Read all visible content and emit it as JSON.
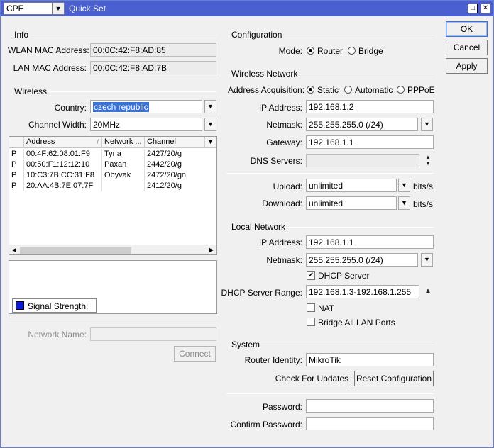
{
  "title": {
    "combo": "CPE",
    "text": "Quick Set"
  },
  "buttons": {
    "ok": "OK",
    "cancel": "Cancel",
    "apply": "Apply"
  },
  "info": {
    "label": "Info",
    "wlan_mac_label": "WLAN MAC Address:",
    "wlan_mac": "00:0C:42:F8:AD:85",
    "lan_mac_label": "LAN MAC Address:",
    "lan_mac": "00:0C:42:F8:AD:7B"
  },
  "wireless": {
    "label": "Wireless",
    "country_label": "Country:",
    "country": "czech republic",
    "channel_width_label": "Channel Width:",
    "channel_width": "20MHz",
    "columns": [
      "",
      "Address",
      "Network ...",
      "Channel"
    ],
    "rows": [
      [
        "P",
        "00:4F:62:08:01:F9",
        "Tyna",
        "2427/20/g"
      ],
      [
        "P",
        "00:50:F1:12:12:10",
        "Paxan",
        "2442/20/g"
      ],
      [
        "P",
        "10:C3:7B:CC:31:F8",
        "Obyvak",
        "2472/20/gn"
      ],
      [
        "P",
        "20:AA:4B:7E:07:7F",
        "",
        "2412/20/g"
      ]
    ],
    "signal_legend": "Signal Strength:",
    "signal_color": "#0a18d8",
    "network_name_label": "Network Name:",
    "network_name": "",
    "connect": "Connect"
  },
  "configuration": {
    "label": "Configuration",
    "mode_label": "Mode:",
    "mode_router": "Router",
    "mode_bridge": "Bridge"
  },
  "wireless_network": {
    "label": "Wireless Network",
    "acq_label": "Address Acquisition:",
    "acq_static": "Static",
    "acq_auto": "Automatic",
    "acq_pppoe": "PPPoE",
    "ip_label": "IP Address:",
    "ip": "192.168.1.2",
    "netmask_label": "Netmask:",
    "netmask": "255.255.255.0 (/24)",
    "gateway_label": "Gateway:",
    "gateway": "192.168.1.1",
    "dns_label": "DNS Servers:",
    "dns": "",
    "upload_label": "Upload:",
    "upload": "unlimited",
    "upload_unit": "bits/s",
    "download_label": "Download:",
    "download": "unlimited",
    "download_unit": "bits/s"
  },
  "local_network": {
    "label": "Local Network",
    "ip_label": "IP Address:",
    "ip": "192.168.1.1",
    "netmask_label": "Netmask:",
    "netmask": "255.255.255.0 (/24)",
    "dhcp_server": "DHCP Server",
    "dhcp_range_label": "DHCP Server Range:",
    "dhcp_range": "192.168.1.3-192.168.1.255",
    "nat": "NAT",
    "bridge_all": "Bridge All LAN Ports"
  },
  "system": {
    "label": "System",
    "identity_label": "Router Identity:",
    "identity": "MikroTik",
    "check_updates": "Check For Updates",
    "reset_config": "Reset Configuration",
    "password_label": "Password:",
    "password": "",
    "confirm_label": "Confirm Password:",
    "confirm": ""
  }
}
